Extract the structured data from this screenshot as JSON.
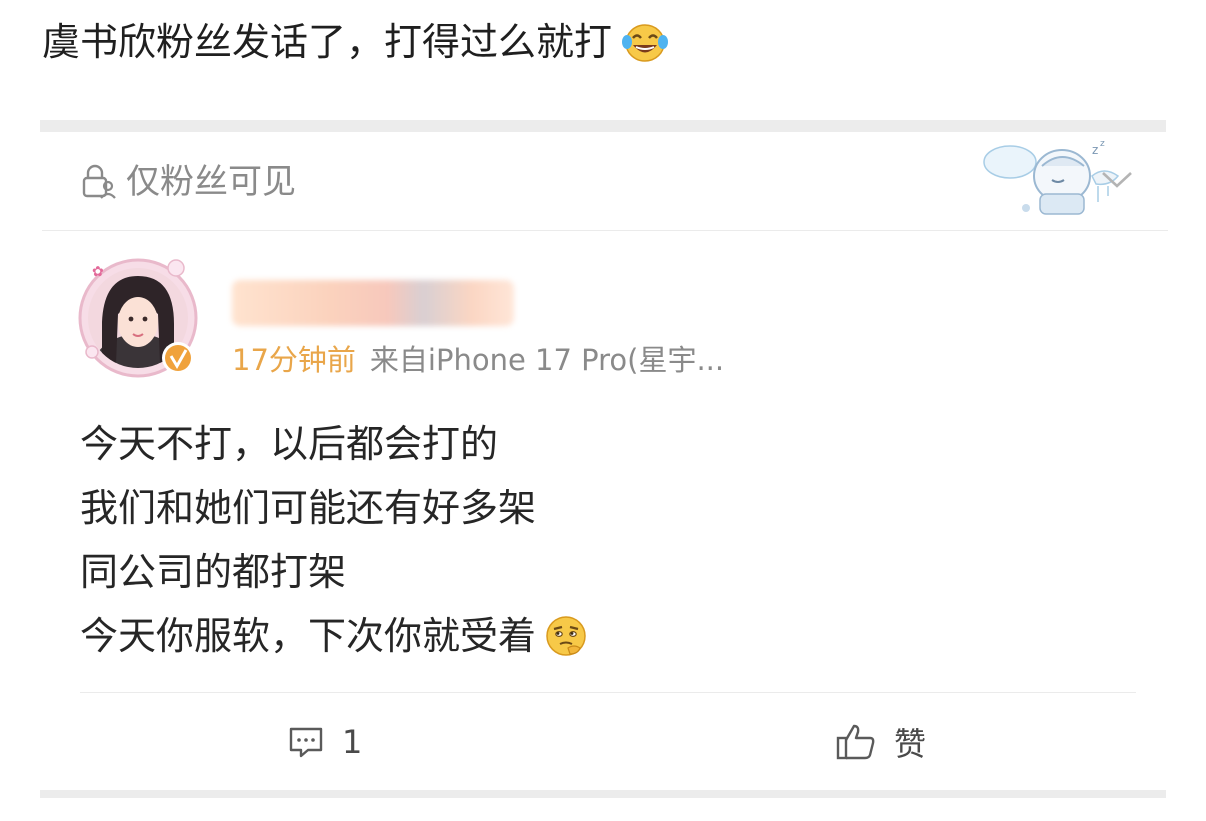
{
  "headline": {
    "text": "虞书欣粉丝发话了，打得过么就打",
    "emoji": "tears-of-joy-emoji"
  },
  "card": {
    "visibility_label": "仅粉丝可见",
    "visibility_icon": "lock-person-icon",
    "sticker": "sleeping-cartoon-sticker",
    "menu_icon": "chevron-down-icon"
  },
  "post": {
    "time": "17分钟前",
    "source": "来自iPhone 17 Pro(星宇...",
    "verified_badge": "orange-verified-badge",
    "lines": [
      "今天不打，以后都会打的",
      "我们和她们可能还有好多架",
      "同公司的都打架",
      "今天你服软，下次你就受着"
    ],
    "last_line_emoji": "thinking-emoji"
  },
  "actions": {
    "comment_count": "1",
    "like_label": "赞"
  },
  "colors": {
    "time": "#e9a64a",
    "muted": "#8a8a8a",
    "divider": "#ececec"
  }
}
